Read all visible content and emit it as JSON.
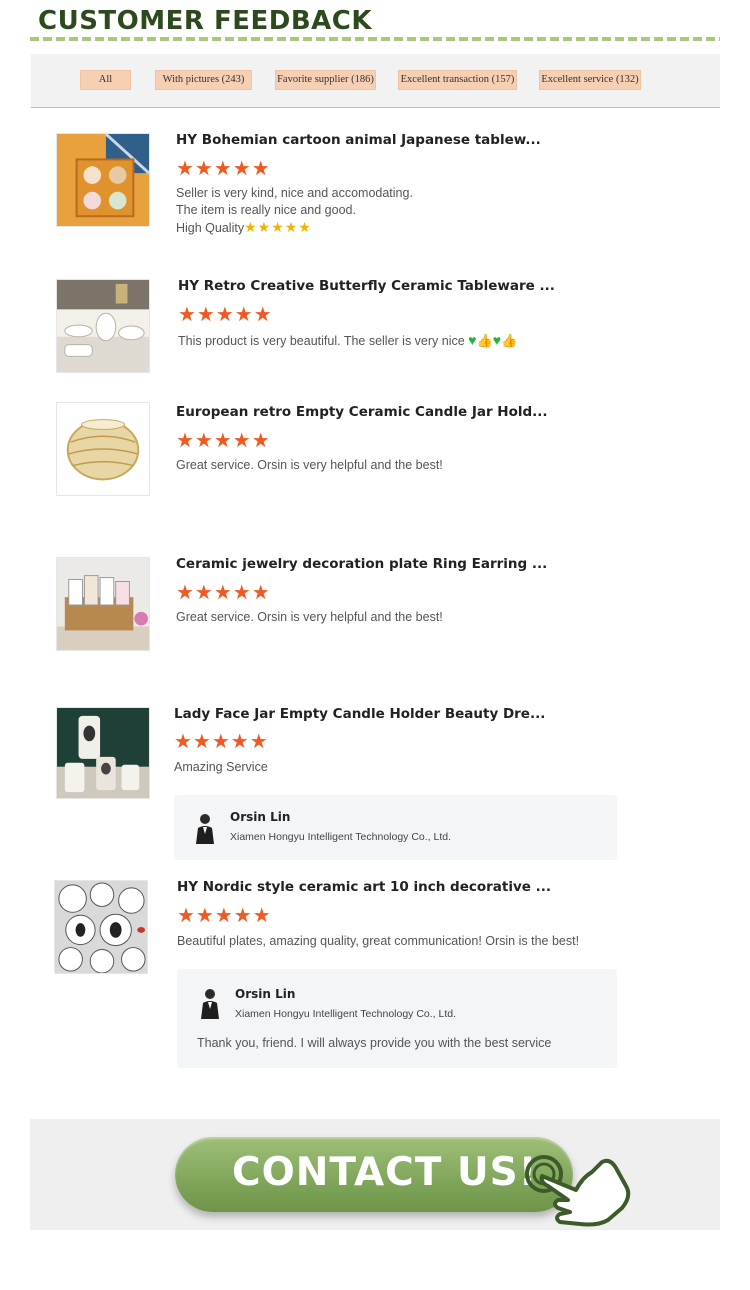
{
  "header": {
    "title": "CUSTOMER FEEDBACK"
  },
  "filters": [
    {
      "label": "All"
    },
    {
      "label": "With pictures (243)"
    },
    {
      "label": "Favorite supplier (186)"
    },
    {
      "label": "Excellent transaction (157)"
    },
    {
      "label": "Excellent service (132)"
    }
  ],
  "reviews": [
    {
      "title": "HY Bohemian cartoon animal Japanese tablew...",
      "rating": "★★★★★",
      "lines": [
        "Seller is very kind, nice and accomodating.",
        "The item is really nice and good.",
        "High Quality"
      ],
      "mini_rating": "★★★★★"
    },
    {
      "title": "HY Retro Creative Butterfly Ceramic Tableware ...",
      "rating": "★★★★★",
      "lines": [
        "This product is very beautiful. The seller is very nice"
      ]
    },
    {
      "title": "European retro Empty Ceramic Candle Jar Hold...",
      "rating": "★★★★★",
      "lines": [
        "Great service. Orsin is very helpful and the best!"
      ]
    },
    {
      "title": "Ceramic jewelry decoration plate Ring Earring ...",
      "rating": "★★★★★",
      "lines": [
        "Great service. Orsin is very helpful and the best!"
      ]
    },
    {
      "title": "Lady Face Jar Empty Candle Holder Beauty Dre...",
      "rating": "★★★★★",
      "lines": [
        "Amazing Service"
      ],
      "reply": {
        "name": "Orsin Lin",
        "company": "Xiamen Hongyu Intelligent Technology Co., Ltd."
      }
    },
    {
      "title": "HY Nordic style ceramic art 10 inch decorative ...",
      "rating": "★★★★★",
      "lines": [
        "Beautiful plates, amazing quality, great communication! Orsin is the best!"
      ],
      "reply": {
        "name": "Orsin Lin",
        "company": "Xiamen Hongyu Intelligent Technology Co., Ltd.",
        "text": "Thank you, friend. I will always provide you with the best service"
      }
    }
  ],
  "contact": {
    "label": "CONTACT US!"
  },
  "icons": {
    "star": "star-icon",
    "heart": "green-heart-icon",
    "thumb": "thumbs-up-icon",
    "hand": "pointing-hand-icon"
  },
  "colors": {
    "accent": "#f05a22",
    "header": "#2d4a1e",
    "button": "#85a95e",
    "chip": "#f7cfb2"
  }
}
